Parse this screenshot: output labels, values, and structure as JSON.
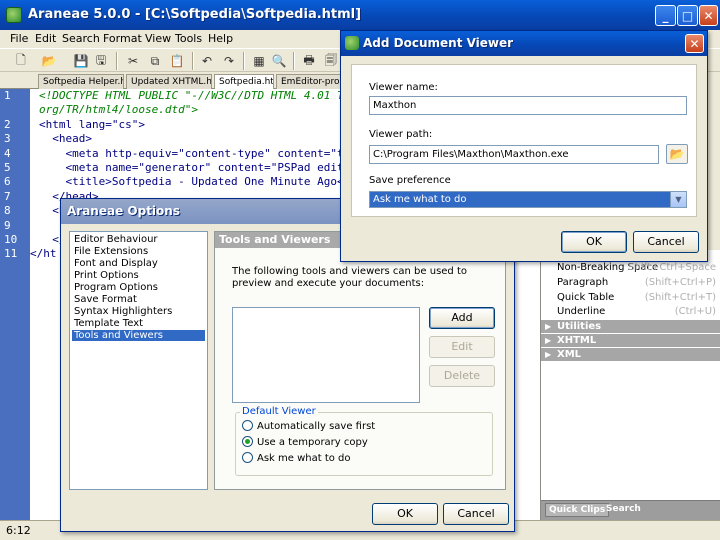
{
  "window": {
    "title": "Araneae 5.0.0 - [C:\\Softpedia\\Softpedia.html]"
  },
  "menu": [
    "File",
    "Edit",
    "Search",
    "Format",
    "View",
    "Tools",
    "Help"
  ],
  "tabs": [
    "Softpedia Helper.htm",
    "Updated XHTML.html",
    "Softpedia.html",
    "EmEditor-pro--be"
  ],
  "editor": {
    "line_numbers": [
      "1",
      "2",
      "3",
      "4",
      "5",
      "6",
      "7",
      "8",
      "9",
      "10",
      "11"
    ],
    "lines": [
      "<!DOCTYPE HTML PUBLIC \"-//W3C//DTD HTML 4.01 Tra",
      "org/TR/html4/loose.dtd\">",
      "<html lang=\"cs\">",
      "  <head>",
      "    <meta http-equiv=\"content-type\" content=\"tex",
      "    <meta name=\"generator\" content=\"PSPad editor",
      "    <title>Softpedia - Updated One Minute Ago</t",
      "  </head>",
      "  <b",
      "  </",
      "</ht"
    ]
  },
  "right_panel": {
    "items": [
      {
        "label": "Non-Breaking Space",
        "shortcut": "Shift+Ctrl+Space"
      },
      {
        "label": "Paragraph",
        "shortcut": "(Shift+Ctrl+P)"
      },
      {
        "label": "Quick Table",
        "shortcut": "(Shift+Ctrl+T)"
      },
      {
        "label": "Underline",
        "shortcut": "(Ctrl+U)"
      }
    ],
    "sections": [
      "Utilities",
      "XHTML",
      "XML"
    ],
    "tabs": [
      "Quick Clips",
      "Search"
    ]
  },
  "status": {
    "position": "6:12"
  },
  "options_dialog": {
    "title": "Araneae Options",
    "list": [
      "Editor Behaviour",
      "File Extensions",
      "Font and Display",
      "Print Options",
      "Program Options",
      "Save Format",
      "Syntax Highlighters",
      "Template Text",
      "Tools and Viewers"
    ],
    "selected_index": 8,
    "pane_title": "Tools and Viewers",
    "description": "The following tools and viewers can be used to preview and execute your documents:",
    "buttons": {
      "add": "Add",
      "edit": "Edit",
      "delete": "Delete",
      "ok": "OK",
      "cancel": "Cancel"
    },
    "default_viewer": {
      "legend": "Default Viewer",
      "options": [
        "Automatically save first",
        "Use a temporary copy",
        "Ask me what to do"
      ],
      "selected_index": 1
    }
  },
  "add_viewer_dialog": {
    "title": "Add Document Viewer",
    "name_label": "Viewer name:",
    "name_value": "Maxthon",
    "path_label": "Viewer path:",
    "path_value": "C:\\Program Files\\Maxthon\\Maxthon.exe",
    "pref_label": "Save preference",
    "pref_value": "Ask me what to do",
    "ok": "OK",
    "cancel": "Cancel"
  }
}
